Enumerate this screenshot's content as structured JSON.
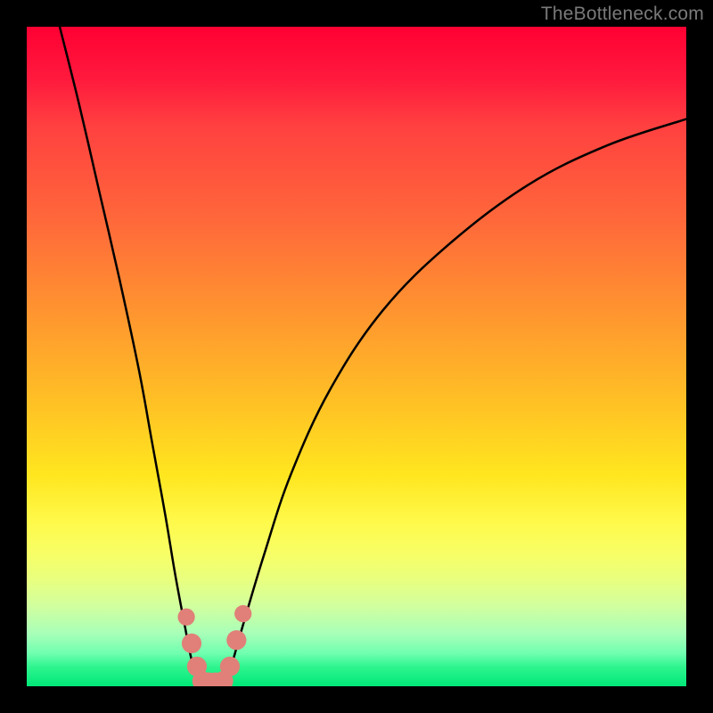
{
  "watermark": "TheBottleneck.com",
  "chart_data": {
    "type": "line",
    "title": "",
    "xlabel": "",
    "ylabel": "",
    "xlim": [
      0,
      100
    ],
    "ylim": [
      0,
      100
    ],
    "background_gradient_stops": [
      {
        "pos": 0,
        "color": "#ff0033"
      },
      {
        "pos": 30,
        "color": "#ff6a3a"
      },
      {
        "pos": 58,
        "color": "#ffc424"
      },
      {
        "pos": 75,
        "color": "#fff94a"
      },
      {
        "pos": 88,
        "color": "#d0ffa0"
      },
      {
        "pos": 100,
        "color": "#00e878"
      }
    ],
    "series": [
      {
        "name": "left-branch",
        "x": [
          5,
          8,
          11,
          14,
          17,
          19,
          21,
          22.5,
          24,
          25,
          26,
          26.5
        ],
        "y": [
          100,
          88,
          75,
          62,
          48,
          37,
          26,
          17,
          9,
          4,
          1,
          0
        ]
      },
      {
        "name": "right-branch",
        "x": [
          30,
          31,
          33,
          36,
          40,
          46,
          54,
          64,
          76,
          88,
          100
        ],
        "y": [
          0,
          3,
          10,
          20,
          32,
          45,
          57,
          67,
          76,
          82,
          86
        ]
      },
      {
        "name": "valley-floor",
        "x": [
          26.5,
          27,
          28,
          29,
          30
        ],
        "y": [
          0,
          0,
          0,
          0,
          0
        ]
      }
    ],
    "markers": [
      {
        "x": 24.2,
        "y": 10.5,
        "r": 1.3
      },
      {
        "x": 25.0,
        "y": 6.5,
        "r": 1.5
      },
      {
        "x": 25.8,
        "y": 3.0,
        "r": 1.5
      },
      {
        "x": 26.6,
        "y": 0.8,
        "r": 1.5
      },
      {
        "x": 27.6,
        "y": 0.5,
        "r": 1.6
      },
      {
        "x": 28.6,
        "y": 0.5,
        "r": 1.6
      },
      {
        "x": 29.8,
        "y": 0.8,
        "r": 1.5
      },
      {
        "x": 30.8,
        "y": 3.0,
        "r": 1.5
      },
      {
        "x": 31.8,
        "y": 7.0,
        "r": 1.5
      },
      {
        "x": 32.8,
        "y": 11.0,
        "r": 1.3
      }
    ],
    "marker_color": "#e08078",
    "curve_color": "#000000"
  }
}
